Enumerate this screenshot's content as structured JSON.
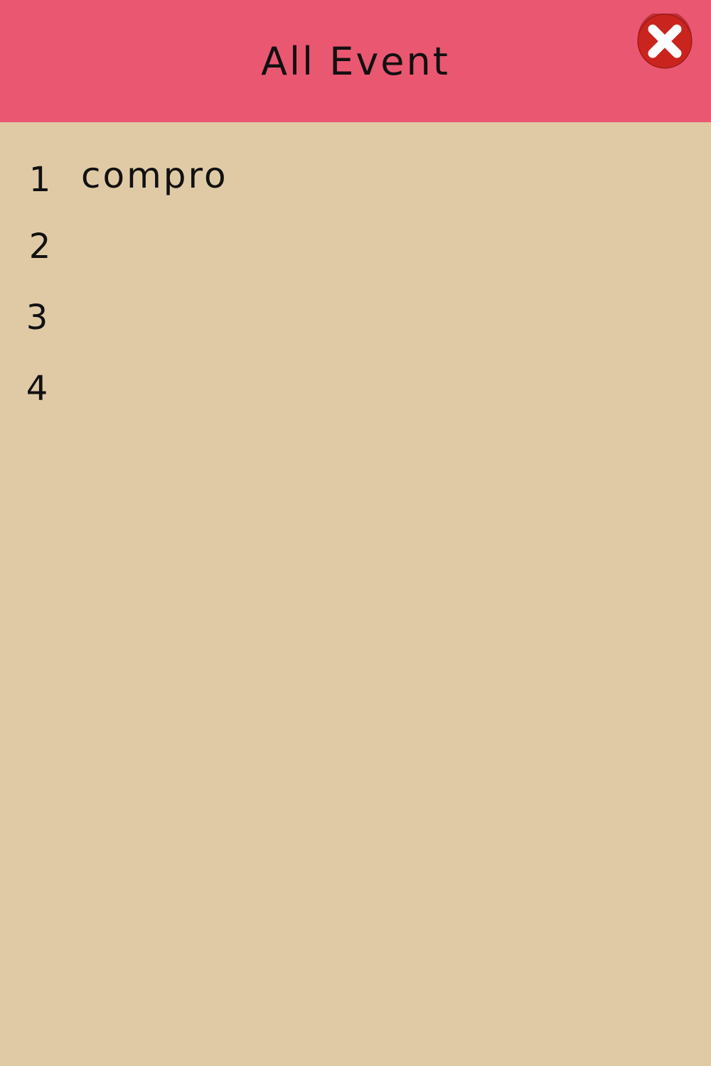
{
  "header": {
    "title": "All Event",
    "close_icon": "close-icon"
  },
  "colors": {
    "header_bg": "#ea5771",
    "body_bg": "#e0caa6",
    "close_red": "#c9241d",
    "close_dark": "#9e1410"
  },
  "events": [
    {
      "number": "1",
      "name": "compro"
    },
    {
      "number": "2",
      "name": ""
    },
    {
      "number": "3",
      "name": ""
    },
    {
      "number": "4",
      "name": ""
    }
  ]
}
